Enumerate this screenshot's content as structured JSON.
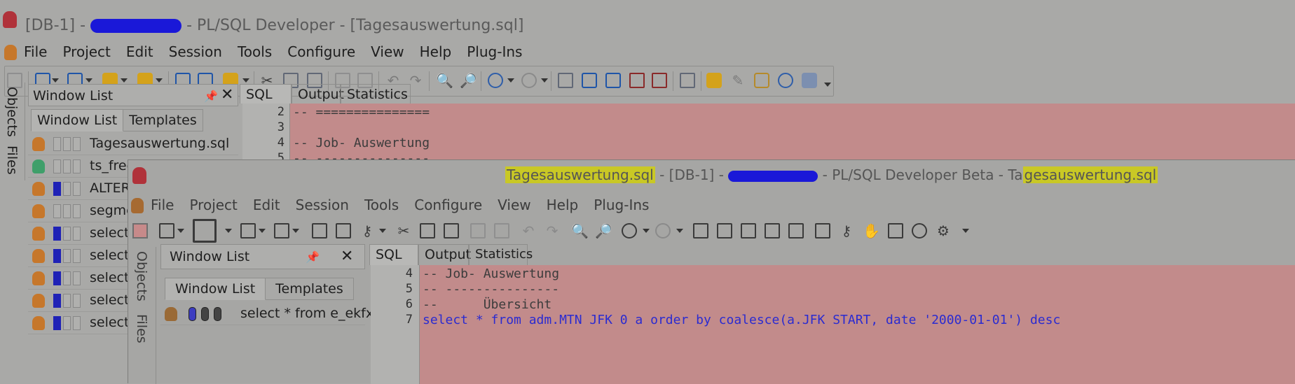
{
  "back_window": {
    "title_prefix": "[DB-1] -",
    "title_suffix": "- PL/SQL Developer - [Tagesauswertung.sql]",
    "menu": [
      "File",
      "Project",
      "Edit",
      "Session",
      "Tools",
      "Configure",
      "View",
      "Help",
      "Plug-Ins"
    ],
    "vertical_tabs": [
      "Objects",
      "Files"
    ],
    "window_list": {
      "title": "Window List",
      "tabs": [
        "Window List",
        "Templates"
      ],
      "rows": [
        {
          "label": "Tagesauswertung.sql",
          "icon": "db-orange"
        },
        {
          "label": "ts_free",
          "icon": "db-green"
        },
        {
          "label": "ALTER",
          "icon": "db-orange"
        },
        {
          "label": "segme",
          "icon": "db-orange"
        },
        {
          "label": "select",
          "icon": "db-orange"
        },
        {
          "label": "select",
          "icon": "db-orange"
        },
        {
          "label": "select",
          "icon": "db-orange"
        },
        {
          "label": "select",
          "icon": "db-orange"
        },
        {
          "label": "select",
          "icon": "db-orange"
        }
      ]
    },
    "editor_tabs": [
      "SQL",
      "Output",
      "Statistics"
    ],
    "code": [
      {
        "n": "2",
        "text": "-- ==============="
      },
      {
        "n": "3",
        "text": ""
      },
      {
        "n": "4",
        "text": "-- Job- Auswertung"
      },
      {
        "n": "5",
        "text": "-- ---------------"
      }
    ]
  },
  "front_window": {
    "title_hl1": "Tagesauswertung.sql",
    "title_mid1": "- [DB-1] -",
    "title_mid2": "- PL/SQL Developer Beta - Ta",
    "title_hl2": "gesauswertung.sql",
    "menu": [
      "File",
      "Project",
      "Edit",
      "Session",
      "Tools",
      "Configure",
      "View",
      "Help",
      "Plug-Ins"
    ],
    "vertical_tabs": [
      "Objects",
      "Files"
    ],
    "window_list": {
      "title": "Window List",
      "tabs": [
        "Window List",
        "Templates"
      ],
      "row_label": "select * from e_ekfx v"
    },
    "editor_tabs": [
      "SQL",
      "Output",
      "Statistics"
    ],
    "code": [
      {
        "n": "4",
        "text": "-- Job- Auswertung"
      },
      {
        "n": "5",
        "text": "-- ---------------"
      },
      {
        "n": "6",
        "text": "--      Übersicht"
      },
      {
        "n": "7",
        "text": "select * from adm.MTN JFK 0 a order by coalesce(a.JFK START, date '2000-01-01') desc"
      }
    ]
  },
  "colors": {
    "editor_bg": "#c28b8b",
    "highlight": "#c9c825",
    "redaction": "#1a18d8"
  }
}
